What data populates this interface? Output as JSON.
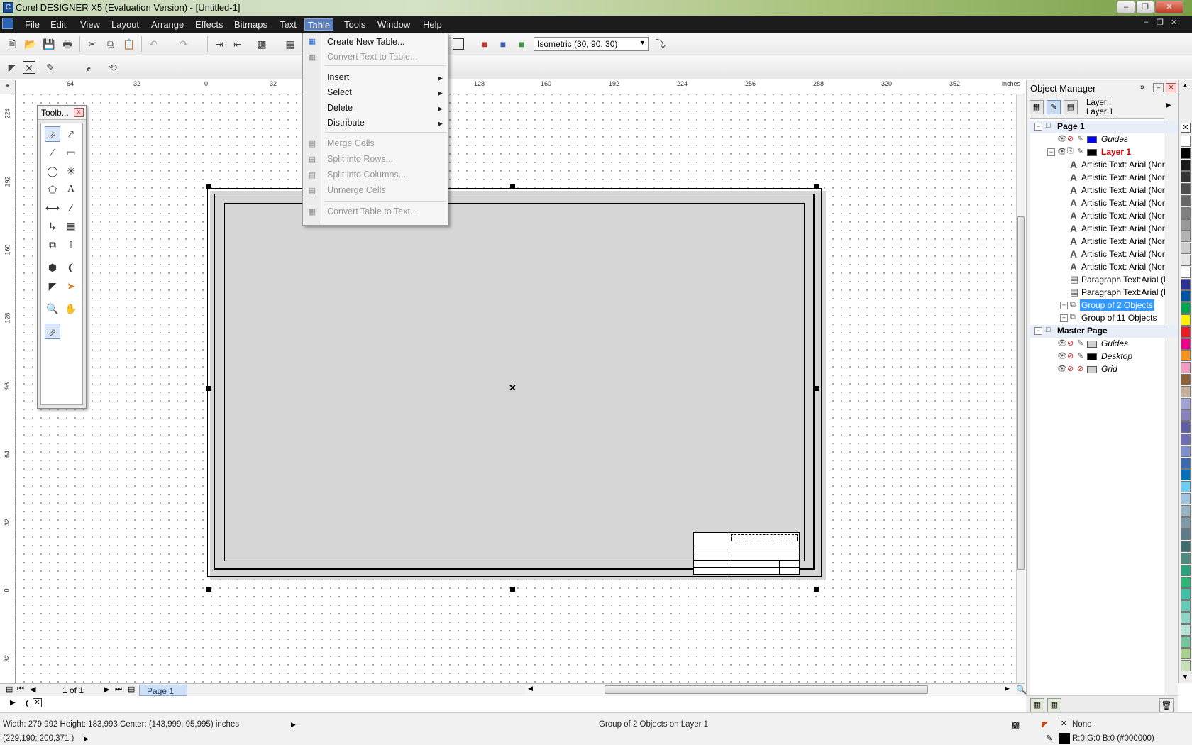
{
  "window": {
    "title": "Corel DESIGNER X5 (Evaluation Version) - [Untitled-1]"
  },
  "menubar": {
    "items": [
      {
        "label": "File"
      },
      {
        "label": "Edit"
      },
      {
        "label": "View"
      },
      {
        "label": "Layout"
      },
      {
        "label": "Arrange"
      },
      {
        "label": "Effects"
      },
      {
        "label": "Bitmaps"
      },
      {
        "label": "Text"
      },
      {
        "label": "Table"
      },
      {
        "label": "Tools"
      },
      {
        "label": "Window"
      },
      {
        "label": "Help"
      }
    ],
    "active": "Table"
  },
  "toolbar": {
    "projection_preset": "Isometric (30, 90, 30)"
  },
  "table_menu": {
    "items": [
      {
        "label": "Create New Table...",
        "enabled": true
      },
      {
        "label": "Convert Text to Table...",
        "enabled": false
      },
      {
        "label": "Insert",
        "enabled": true,
        "submenu": true
      },
      {
        "label": "Select",
        "enabled": true,
        "submenu": true
      },
      {
        "label": "Delete",
        "enabled": true,
        "submenu": true
      },
      {
        "label": "Distribute",
        "enabled": true,
        "submenu": true
      },
      {
        "label": "Merge Cells",
        "enabled": false
      },
      {
        "label": "Split into Rows...",
        "enabled": false
      },
      {
        "label": "Split into Columns...",
        "enabled": false
      },
      {
        "label": "Unmerge Cells",
        "enabled": false
      },
      {
        "label": "Convert Table to Text...",
        "enabled": false
      }
    ]
  },
  "ruler": {
    "units": "inches",
    "h_ticks": [
      "64",
      "32",
      "0",
      "32",
      "128",
      "160",
      "192",
      "224",
      "256",
      "288",
      "320",
      "352"
    ],
    "v_ticks": [
      "224",
      "192",
      "160",
      "128",
      "96",
      "64",
      "32",
      "0",
      "32"
    ]
  },
  "toolbox": {
    "title": "Toolb..."
  },
  "object_manager": {
    "title": "Object Manager",
    "layer_caption": "Layer:",
    "layer_name": "Layer 1",
    "page1": "Page 1",
    "guides": "Guides",
    "layer1": "Layer 1",
    "objects": [
      "Artistic Text: Arial (Norm",
      "Artistic Text: Arial (Norm",
      "Artistic Text: Arial (Norm",
      "Artistic Text: Arial (Norm",
      "Artistic Text: Arial (Norm",
      "Artistic Text: Arial (Norm",
      "Artistic Text: Arial (Norm",
      "Artistic Text: Arial (Norm",
      "Artistic Text: Arial (Norm",
      "Paragraph Text:Arial (No",
      "Paragraph Text:Arial (Bol"
    ],
    "group_selected": "Group of 2 Objects",
    "group_other": "Group of 11 Objects",
    "master_page": "Master Page",
    "master_guides": "Guides",
    "master_desktop": "Desktop",
    "master_grid": "Grid",
    "colors": {
      "guides": "#0000ff",
      "layer1": "#000000",
      "selection": "#3399ff",
      "active_layer_text": "#cc0000"
    }
  },
  "navigator": {
    "page_count": "1 of 1",
    "page_tab": "Page 1"
  },
  "status": {
    "dimensions": "Width: 279,992  Height: 183,993  Center: (143,999; 95,995)  inches",
    "cursor": "(229,190; 200,371 )",
    "selection": "Group of 2 Objects on Layer 1",
    "fill": "None",
    "outline": "R:0 G:0 B:0 (#000000)"
  },
  "palette": [
    "#ffffff",
    "#000000",
    "#1a1a1a",
    "#333333",
    "#4d4d4d",
    "#666666",
    "#808080",
    "#999999",
    "#b3b3b3",
    "#cccccc",
    "#e6e6e6",
    "#ffffff",
    "#2e3192",
    "#0054a6",
    "#00a651",
    "#fff200",
    "#ed1c24",
    "#ec008c",
    "#f7941d",
    "#f49ac1",
    "#8c6239",
    "#c7b299",
    "#a3a1d6",
    "#8781bd",
    "#605ca8",
    "#6c6db5",
    "#7f8fcb",
    "#3b6ab3",
    "#0072bc",
    "#6dcff6",
    "#a0c4df",
    "#9ab5c3",
    "#7e9aa8",
    "#5d7c8a",
    "#3e6f6e",
    "#4c8b7d",
    "#27a37f",
    "#2bb673",
    "#40c0a4",
    "#64cdb6",
    "#8dd6c5",
    "#b7e3d6",
    "#74c69d",
    "#a9d18e",
    "#c5e0b4"
  ]
}
